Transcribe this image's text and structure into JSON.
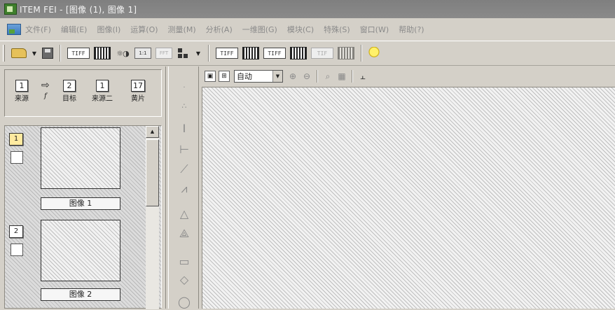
{
  "window": {
    "title": "ITEM FEI - [图像 (1), 图像 1]"
  },
  "menu": [
    "文件(F)",
    "编辑(E)",
    "图像(I)",
    "运算(O)",
    "测量(M)",
    "分析(A)",
    "一维图(G)",
    "模块(C)",
    "特殊(S)",
    "窗口(W)",
    "帮助(?)"
  ],
  "toolbar": {
    "film_labels": [
      "TIFF",
      "TIFF",
      "1:1",
      "TIFF",
      "TIF",
      "TIF",
      "TIF"
    ],
    "icons": [
      "open-folder-icon",
      "dropdown-arrow-icon",
      "save-disk-icon",
      "image-film-icon",
      "image-stack-icon",
      "contrast-dots-icon",
      "image-info-icon",
      "fft-icon",
      "tree-icon",
      "lightbulb-icon"
    ]
  },
  "source_panel": {
    "source": {
      "num": "1",
      "label": "来源"
    },
    "function": {
      "label": "f"
    },
    "target": {
      "num": "2",
      "label": "目标"
    },
    "source2": {
      "num": "1",
      "label": "来源二"
    },
    "frames": {
      "num": "17",
      "label": "黄片"
    }
  },
  "thumbnails": [
    {
      "num": "1",
      "caption": "图像 1",
      "selected": true
    },
    {
      "num": "2",
      "caption": "图像 2",
      "selected": false
    }
  ],
  "image_toolbar": {
    "zoom": "自动"
  },
  "colors": {
    "titlebar": "#8a8a8a",
    "chrome": "#d4d0c8",
    "hatch": "#f2f2f2",
    "highlight": "#ffeaa0"
  }
}
